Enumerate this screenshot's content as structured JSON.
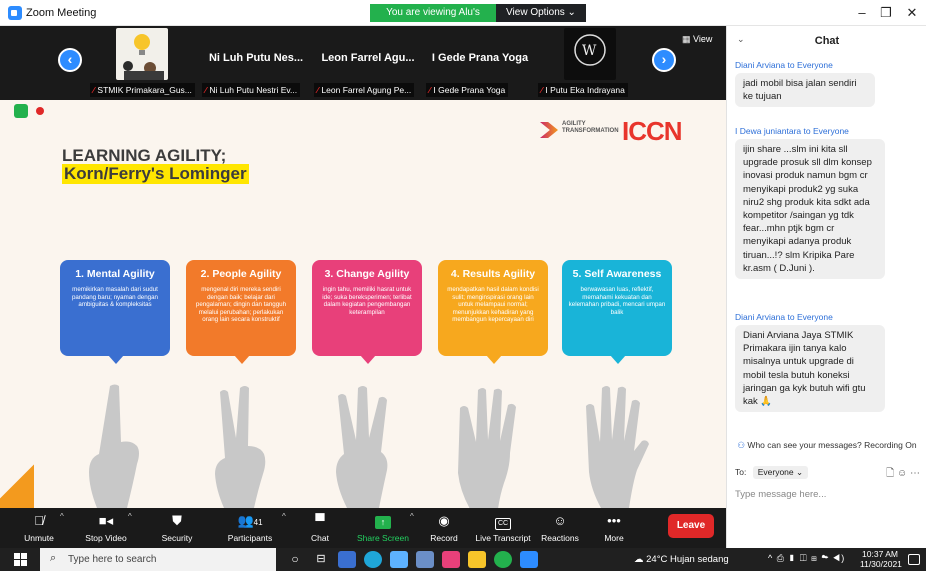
{
  "window": {
    "title": "Zoom Meeting",
    "viewing_banner": "You are viewing Alu's screen",
    "view_options": "View Options ⌄",
    "controls": [
      "–",
      "❐",
      "✕"
    ]
  },
  "strip": {
    "view_label": "▦ View",
    "tiles": [
      {
        "big_name": "",
        "label": "STMIK Primakara_Gus...",
        "thumb_color": "#f5f5f5"
      },
      {
        "big_name": "Ni Luh Putu Nes...",
        "label": "Ni Luh Putu Nestri Ev...",
        "thumb_color": ""
      },
      {
        "big_name": "Leon Farrel Agu...",
        "label": "Leon Farrel Agung Pe...",
        "thumb_color": ""
      },
      {
        "big_name": "I Gede Prana Yoga",
        "label": "I Gede Prana Yoga",
        "thumb_color": ""
      },
      {
        "big_name": "",
        "label": "I Putu Eka Indrayana",
        "thumb_color": "#0d0d0d"
      }
    ]
  },
  "slide": {
    "title": "LEARNING AGILITY;",
    "subtitle": "Korn/Ferry's Lominger",
    "logo_agility": "AGILITY TRANSFORMATION",
    "logo_iccn": "ICCN",
    "cards": [
      {
        "title": "1. Mental Agility",
        "desc": "memikirkan masalah dari sudut pandang baru; nyaman dengan ambiguitas & kompleksitas",
        "color": "#3a6fd0"
      },
      {
        "title": "2. People Agility",
        "desc": "mengenal diri mereka sendiri dengan baik; belajar dari pengalaman; dingin dan tangguh melalui perubahan; perlakukan orang lain secara konstruktif",
        "color": "#f27a2a"
      },
      {
        "title": "3. Change Agility",
        "desc": "ingin tahu, memiliki hasrat untuk ide; suka bereksperimen; terlibat dalam kegiatan pengembangan keterampilan",
        "color": "#e8407a"
      },
      {
        "title": "4. Results Agility",
        "desc": "mendapatkan hasil dalam kondisi sulit; menginspirasi orang lain untuk melampaui normal; menunjukkan kehadiran yang membangun kepercayaan diri",
        "color": "#f7a81e"
      },
      {
        "title": "5. Self Awareness",
        "desc": "berwawasan luas, reflektif, memahami kekuatan dan kelemahan pribadi, mencari umpan balik",
        "color": "#19b4d8"
      }
    ]
  },
  "toolbar": {
    "unmute": "Unmute",
    "stop_video": "Stop Video",
    "security": "Security",
    "participants": "Participants",
    "participants_count": "41",
    "chat": "Chat",
    "share_screen": "Share Screen",
    "record": "Record",
    "live_transcript": "Live Transcript",
    "reactions": "Reactions",
    "more": "More",
    "leave": "Leave"
  },
  "chat": {
    "title": "Chat",
    "messages": [
      {
        "from": "Diani Arviana",
        "to": "to",
        "audience": "Everyone",
        "text": "jadi mobil bisa jalan sendiri ke tujuan"
      },
      {
        "from": "I Dewa juniantara",
        "to": "to",
        "audience": "Everyone",
        "text": "ijin share ...slm ini kita sll upgrade prosuk sll dlm konsep inovasi produk namun bgm cr menyikapi produk2 yg suka niru2 shg produk kita sdkt ada kompetitor /saingan yg tdk fear...mhn ptjk bgm cr menyikapi adanya produk tiruan...!? slm Kripika Pare kr.asm ( D.Juni )."
      },
      {
        "from": "Diani Arviana",
        "to": "to",
        "audience": "Everyone",
        "text": "Diani Arviana Jaya STMIK Primakara ijin tanya kalo misalnya untuk upgrade di mobil tesla butuh koneksi jaringan ga kyk butuh wifi gtu kak 🙏"
      }
    ],
    "privacy_text": "Who can see your messages? Recording On",
    "to_label": "To:",
    "to_value": "Everyone ⌄",
    "input_placeholder": "Type message here..."
  },
  "taskbar": {
    "search_placeholder": "Type here to search",
    "weather": "24°C  Hujan sedang",
    "tray_icons": "^ ⎙ ▮ ◫ ⊞ ☁ ◀)",
    "time": "10:37 AM",
    "date": "11/30/2021"
  }
}
